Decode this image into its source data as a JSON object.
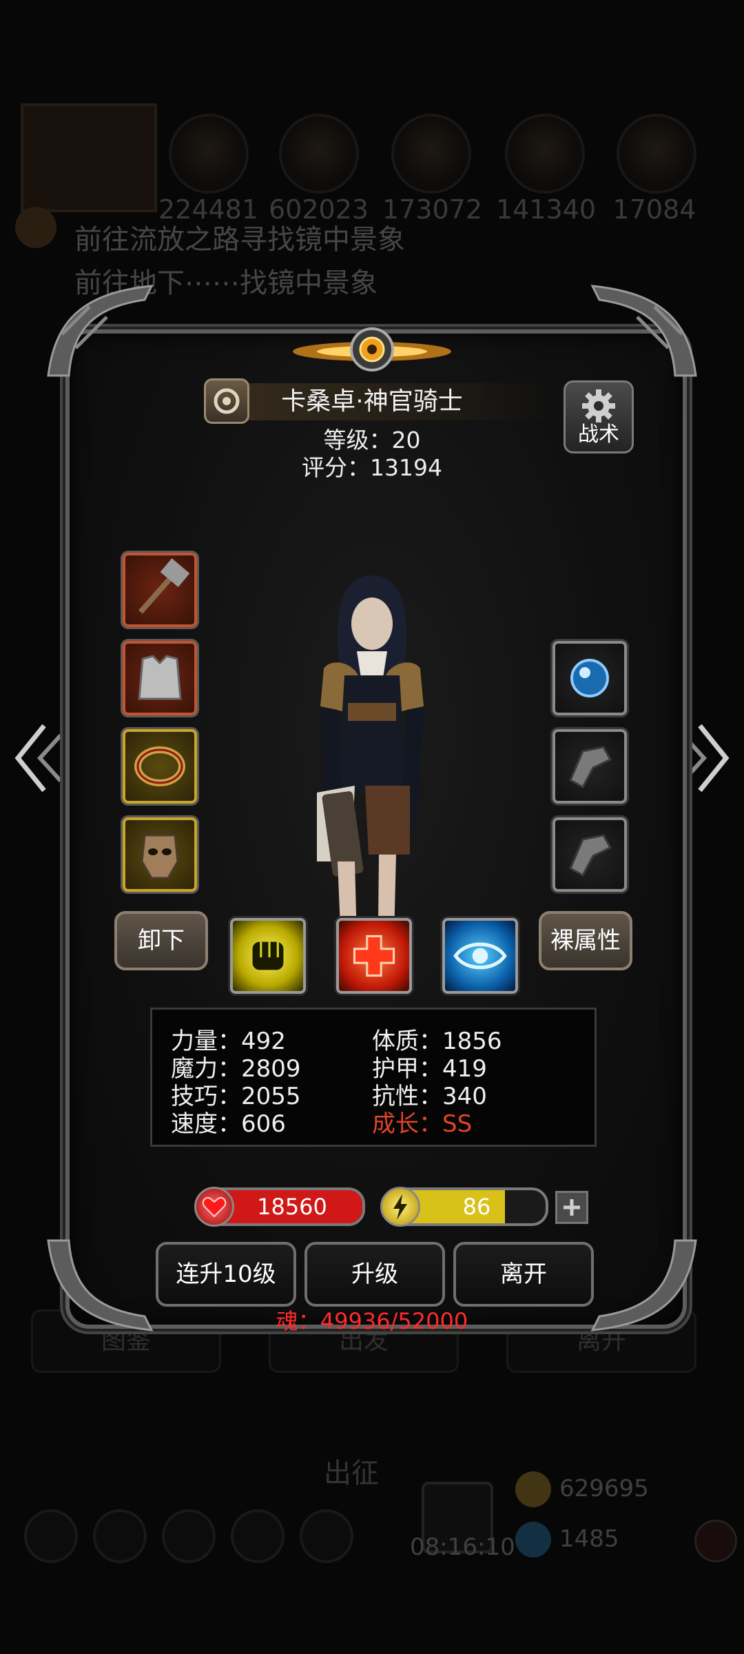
{
  "background": {
    "resources": [
      {
        "icon": "meat-resource-icon",
        "value": "224481"
      },
      {
        "icon": "food-resource-icon",
        "value": "602023"
      },
      {
        "icon": "iron-resource-icon",
        "value": "173072"
      },
      {
        "icon": "crystal-resource-icon",
        "value": "141340"
      },
      {
        "icon": "stone-resource-icon",
        "value": "17084"
      }
    ],
    "quest_1": "前往流放之路寻找镜中景象",
    "quest_2": "前往地下⋯⋯找镜中景象",
    "buttons": [
      "图鉴",
      "出发",
      "离开"
    ],
    "sortie_label": "出征",
    "timer": "08:16:10",
    "gold": "629695",
    "gems": "1485"
  },
  "hero": {
    "name": "卡桑卓·神官骑士",
    "level_text": "等级：20",
    "score_text": "评分：13194",
    "tactic_label": "战术"
  },
  "equipment": {
    "left": [
      {
        "name": "hammer-weapon-slot",
        "rarity": "red"
      },
      {
        "name": "armor-slot",
        "rarity": "red"
      },
      {
        "name": "ring-slot",
        "rarity": "gold"
      },
      {
        "name": "mask-slot",
        "rarity": "gold"
      }
    ],
    "right": [
      {
        "name": "orb-slot",
        "rarity": "common"
      },
      {
        "name": "gauntlet-slot-1",
        "rarity": "common"
      },
      {
        "name": "gauntlet-slot-2",
        "rarity": "common"
      }
    ]
  },
  "actions_mid": {
    "unequip": "卸下",
    "base_attributes": "裸属性"
  },
  "skills": [
    {
      "icon": "fist-skill-icon",
      "color": "#d8d81a"
    },
    {
      "icon": "heal-cross-skill-icon",
      "color": "#e2361c"
    },
    {
      "icon": "eye-skill-icon",
      "color": "#1a8ee0"
    }
  ],
  "stats": {
    "strength": "力量：492",
    "constitution": "体质：1856",
    "magic": "魔力：2809",
    "armor": "护甲：419",
    "skill": "技巧：2055",
    "resistance": "抗性：340",
    "speed": "速度：606",
    "growth": "成长：SS"
  },
  "vitals": {
    "hp": "18560",
    "energy": "86",
    "hp_fill": 1.0,
    "energy_fill": 0.74,
    "hp_color": "#d01818",
    "energy_color": "#d8c21a"
  },
  "buttons": {
    "level_up_10": "连升10级",
    "level_up": "升级",
    "leave": "离开"
  },
  "soul": "魂：49936/52000",
  "colors": {
    "accent_red": "#ff2a2a",
    "growth_orange": "#e0442a"
  }
}
